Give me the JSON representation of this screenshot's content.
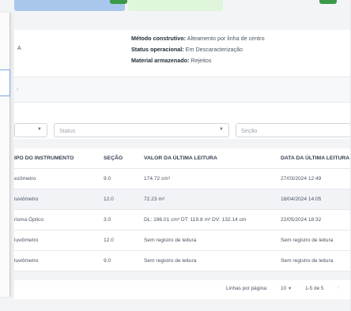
{
  "project": {
    "left_partial": "A",
    "method_label": "Método construtivo:",
    "method_value": " Alteamento por linha de centro",
    "status_label": "Status operacional:",
    "status_value": " Em Descaracterização",
    "material_label": "Material armazenado:",
    "material_value": " Rejeitos"
  },
  "filters": {
    "first_label": "",
    "status_label": "Status",
    "section_label": "Seção"
  },
  "table": {
    "headers": [
      "IPO DO INSTRUMENTO",
      "SEÇÃO",
      "VALOR DA ÚLTIMA LEITURA",
      "DATA DA ÚLTIMA LEITURA"
    ],
    "rows": [
      {
        "type": "ezômetro",
        "section": "9.0",
        "value": "174.72 cm³",
        "date": "27/03/2024 12:49"
      },
      {
        "type": "luviômetro",
        "section": "12.0",
        "value": "72.23 m³",
        "date": "18/04/2024 14:05"
      },
      {
        "type": "risma Óptico",
        "section": "3.0",
        "value": "DL: 196.01 cm³ DT: 119.8 m³ DV: 132.14 cm",
        "date": "22/05/2024 18:32"
      },
      {
        "type": "luviômetro",
        "section": "12.0",
        "value": "Sem registro de leitura",
        "date": "Sem registro de leitura"
      },
      {
        "type": "luviômetro",
        "section": "9.0",
        "value": "Sem registro de leitura",
        "date": "Sem registro de leitura"
      }
    ]
  },
  "pagination": {
    "rows_per_page_label": "Linhas por página:",
    "rows_per_page_value": "10",
    "range_label": "1-5 de 5",
    "prev_icon": "‹"
  },
  "colors": {
    "tab_blue": "#a9c7ec",
    "tab_green": "#dff5dc",
    "accent_green": "#3a9a4a",
    "row_highlight": "#f1f3f6"
  }
}
